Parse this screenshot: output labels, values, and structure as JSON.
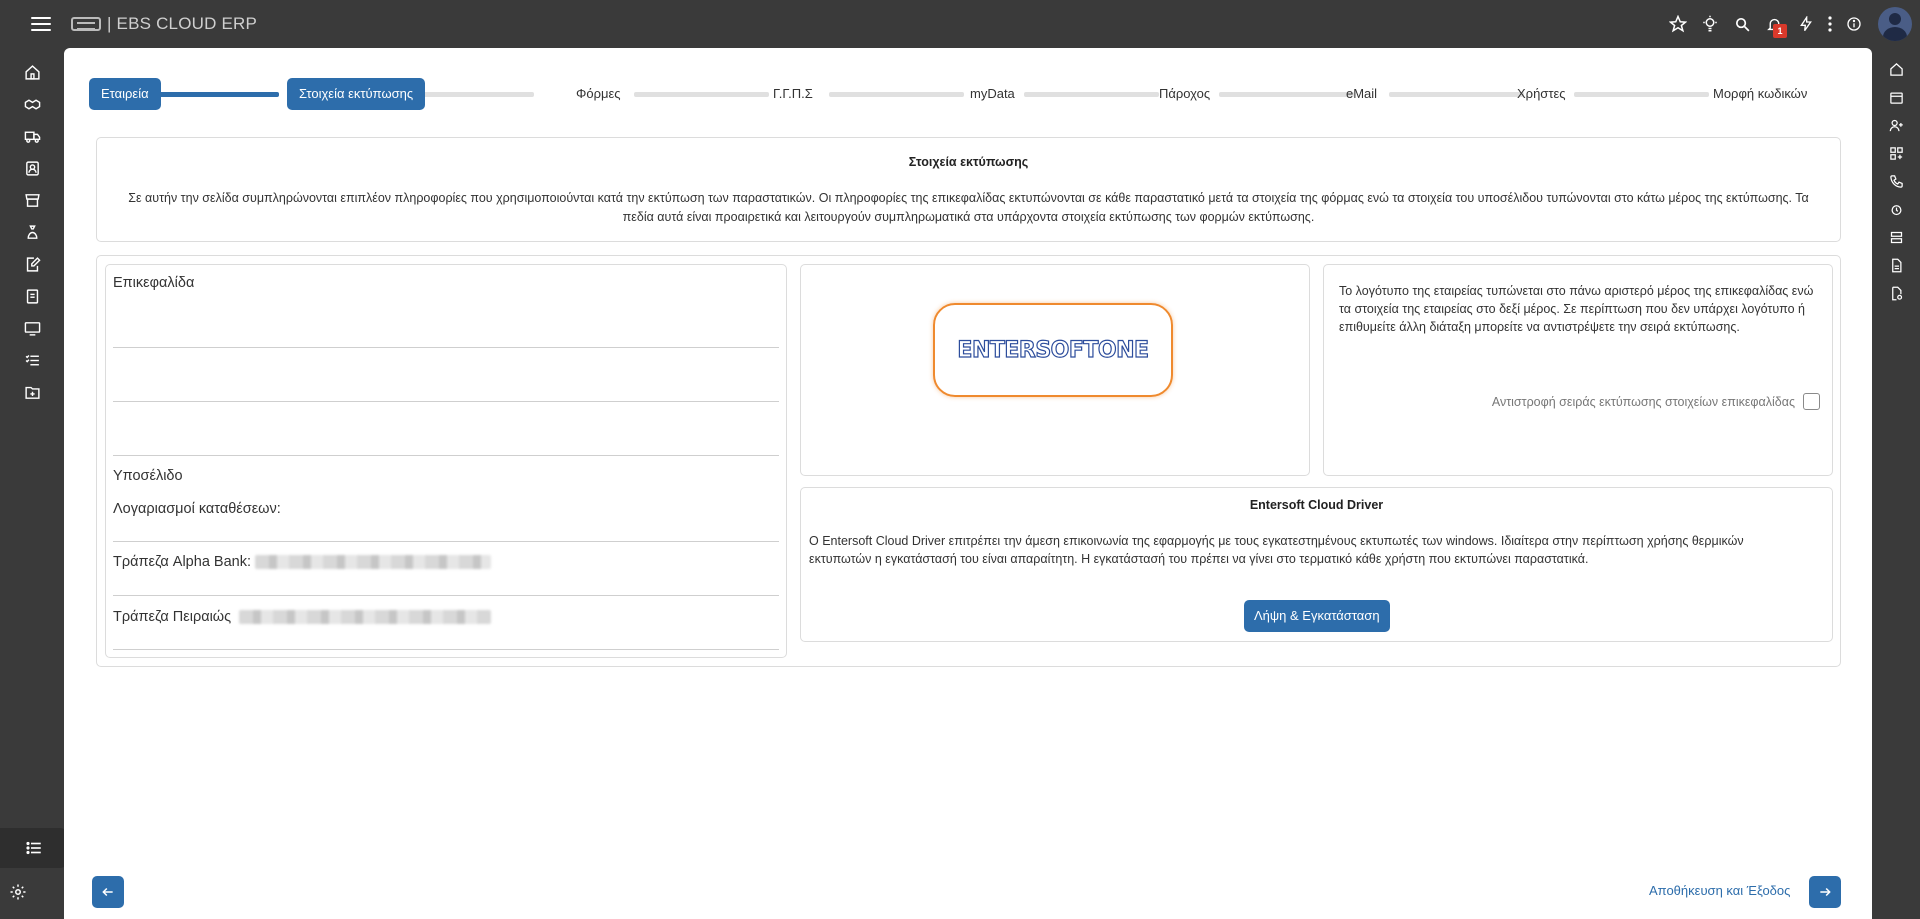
{
  "app": {
    "title": "| EBS CLOUD ERP",
    "notifications_count": "1"
  },
  "topbar_icons": [
    "star-icon",
    "bulb-icon",
    "search-icon",
    "bell-icon",
    "bolt-icon",
    "more-vertical-icon",
    "info-icon",
    "avatar"
  ],
  "left_sidebar_icons": [
    "home-icon",
    "handshake-icon",
    "truck-icon",
    "contact-card-icon",
    "store-icon",
    "money-bag-icon",
    "edit-doc-icon",
    "receipt-icon",
    "monitor-icon",
    "checklist-icon",
    "folder-icon"
  ],
  "right_sidebar_icons": [
    "home-icon",
    "calendar-icon",
    "add-user-icon",
    "apps-icon",
    "phone-icon",
    "alarm-icon",
    "stack-icon",
    "document-icon",
    "file-settings-icon"
  ],
  "stepper": {
    "steps": [
      "Εταιρεία",
      "Στοιχεία εκτύπωσης",
      "Φόρμες",
      "Γ.Γ.Π.Σ",
      "myData",
      "Πάροχος",
      "eMail",
      "Χρήστες",
      "Μορφή κωδικών"
    ],
    "current_step": 2
  },
  "intro": {
    "title": "Στοιχεία εκτύπωσης",
    "text": "Σε αυτήν την σελίδα συμπληρώνονται επιπλέον πληροφορίες που χρησιμοποιούνται κατά την εκτύπωση των παραστατικών. Οι πληροφορίες της επικεφαλίδας εκτυπώνονται σε κάθε παραστατικό μετά τα στοιχεία της φόρμας ενώ τα στοιχεία του υποσέλιδου τυπώνονται στο κάτω μέρος της εκτύπωσης. Τα πεδία αυτά είναι προαιρετικά και λειτουργούν συμπληρωματικά στα υπάρχοντα στοιχεία εκτύπωσης των φορμών εκτύπωσης."
  },
  "header_footer": {
    "header_label": "Επικεφαλίδα",
    "footer_label": "Υποσέλιδο",
    "footer_lines": [
      "Λογαριασμοί καταθέσεων:",
      "Τράπεζα Alpha Bank:",
      "Τράπεζα Πειραιώς"
    ]
  },
  "logo": {
    "text": "ENTERSOFTONE"
  },
  "print_order": {
    "text": "Το λογότυπο της εταιρείας τυπώνεται στο πάνω αριστερό μέρος της επικεφαλίδας ενώ τα στοιχεία της εταιρείας στο δεξί μέρος. Σε περίπτωση που δεν υπάρχει λογότυπο ή επιθυμείτε άλλη διάταξη μπορείτε να αντιστρέψετε την σειρά εκτύπωσης.",
    "checkbox_label": "Αντιστροφή σειράς εκτύπωσης στοιχείων επικεφαλίδας",
    "checked": false
  },
  "driver": {
    "title": "Entersoft Cloud Driver",
    "text": "Ο Entersoft Cloud Driver επιτρέπει την άμεση επικοινωνία της εφαρμογής με τους εγκατεστημένους εκτυπωτές των windows. Ιδιαίτερα στην περίπτωση χρήσης θερμικών εκτυπωτών η εγκατάστασή του είναι απαραίτητη. Η εγκατάστασή του πρέπει να γίνει στο τερματικό κάθε χρήστη που εκτυπώνει παραστατικά.",
    "button_label": "Λήψη & Εγκατάσταση"
  },
  "footer_nav": {
    "save_exit_label": "Αποθήκευση και Έξοδος"
  },
  "colors": {
    "primary": "#2d6dab",
    "chrome": "#3a3a3a",
    "logo_border": "#ef8a2e",
    "badge": "#d9392b"
  }
}
